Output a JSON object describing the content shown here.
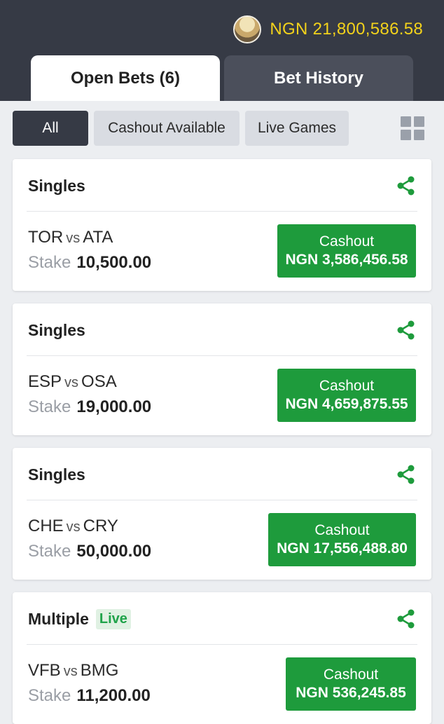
{
  "header": {
    "balance": "NGN 21,800,586.58"
  },
  "tabs": [
    {
      "label": "Open Bets (6)",
      "active": true
    },
    {
      "label": "Bet History",
      "active": false
    }
  ],
  "filters": [
    {
      "label": "All",
      "active": true
    },
    {
      "label": "Cashout Available",
      "active": false
    },
    {
      "label": "Live Games",
      "active": false
    }
  ],
  "bets": [
    {
      "type": "Singles",
      "badge": "",
      "home": "TOR",
      "vs": "vs",
      "away": "ATA",
      "stake_label": "Stake",
      "stake": "10,500.00",
      "cashout_label": "Cashout",
      "cashout_amount": "NGN 3,586,456.58"
    },
    {
      "type": "Singles",
      "badge": "",
      "home": "ESP",
      "vs": "vs",
      "away": "OSA",
      "stake_label": "Stake",
      "stake": "19,000.00",
      "cashout_label": "Cashout",
      "cashout_amount": "NGN 4,659,875.55"
    },
    {
      "type": "Singles",
      "badge": "",
      "home": "CHE",
      "vs": "vs",
      "away": "CRY",
      "stake_label": "Stake",
      "stake": "50,000.00",
      "cashout_label": "Cashout",
      "cashout_amount": "NGN 17,556,488.80"
    },
    {
      "type": "Multiple",
      "badge": "Live",
      "home": "VFB",
      "vs": "vs",
      "away": "BMG",
      "stake_label": "Stake",
      "stake": "11,200.00",
      "cashout_label": "Cashout",
      "cashout_amount": "NGN 536,245.85"
    }
  ],
  "colors": {
    "header_bg": "#363a45",
    "balance_text": "#f3d21b",
    "cashout_green": "#1e9b3c",
    "live_green": "#1fa34a"
  },
  "icons": {
    "share": "share-icon",
    "grid": "grid-view-icon",
    "avatar": "user-avatar"
  }
}
